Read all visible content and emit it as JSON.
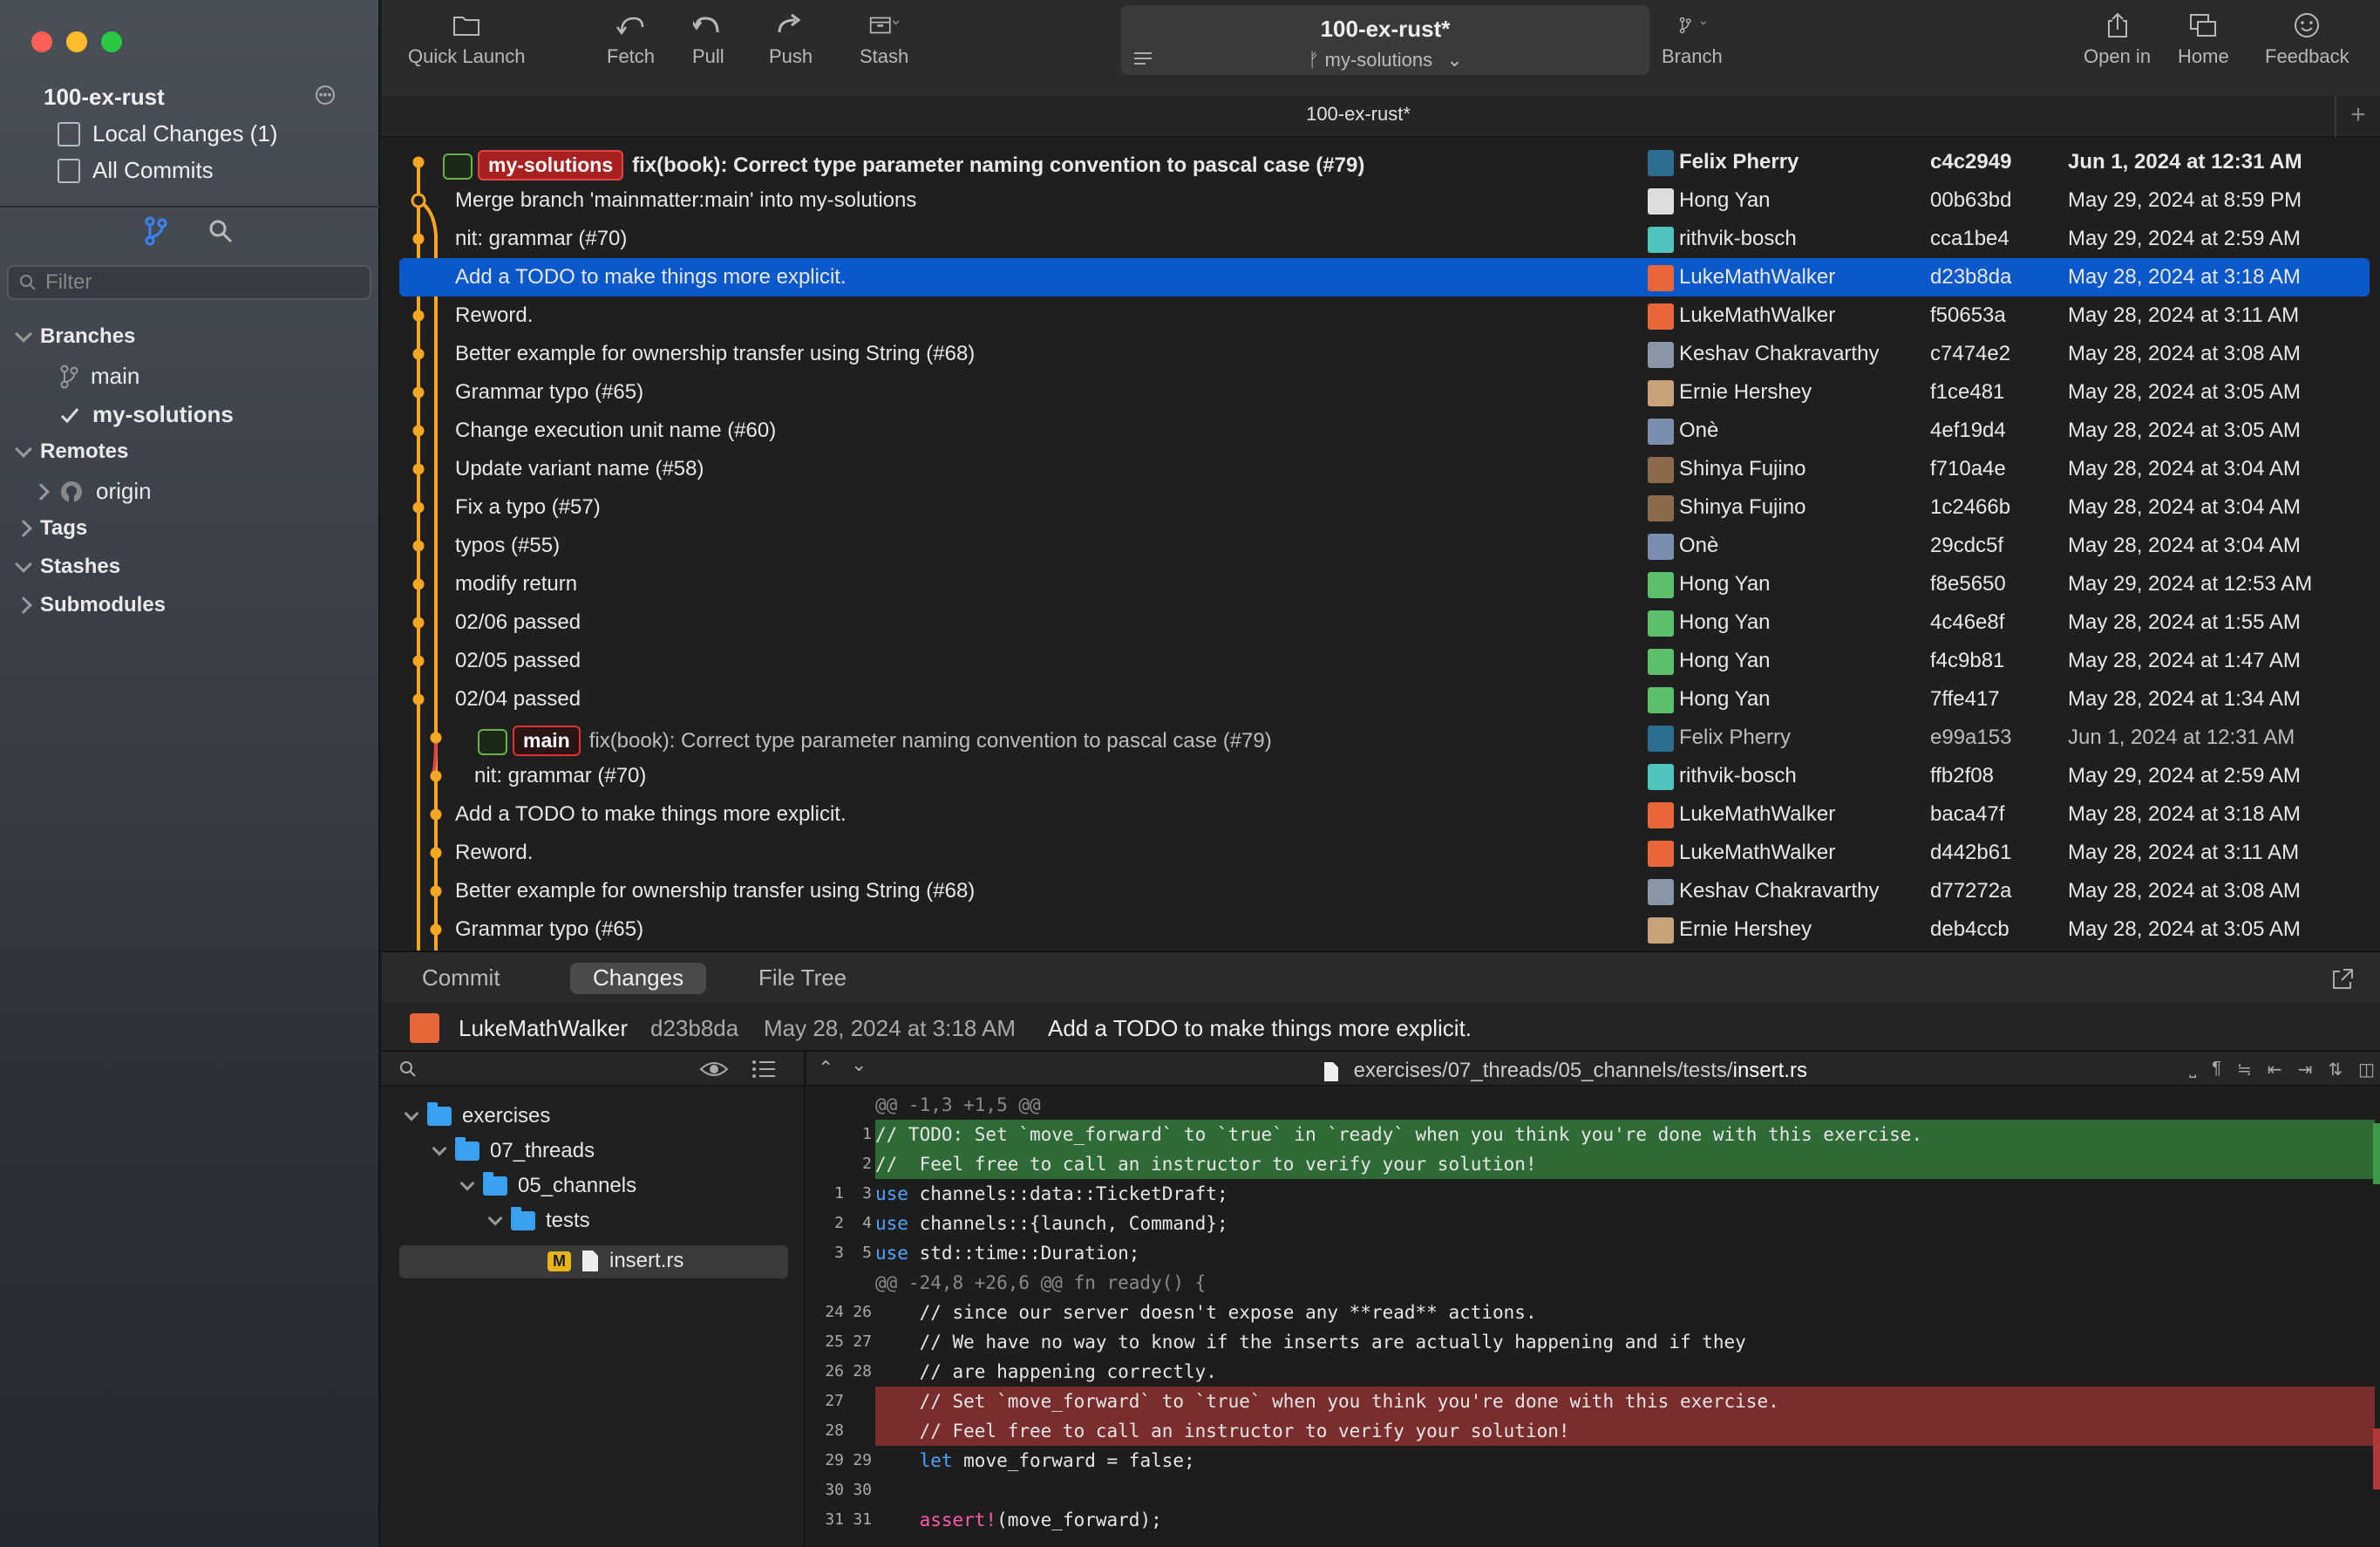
{
  "window": {
    "repo_name": "100-ex-rust"
  },
  "sidebar": {
    "repo_name": "100-ex-rust",
    "local_changes": "Local Changes (1)",
    "all_commits": "All Commits",
    "filter_placeholder": "Filter",
    "branches_header": "Branches",
    "branches": [
      "main",
      "my-solutions"
    ],
    "remotes_header": "Remotes",
    "remotes": [
      "origin"
    ],
    "tags_header": "Tags",
    "stashes_header": "Stashes",
    "submodules_header": "Submodules"
  },
  "toolbar": {
    "quick_launch": "Quick Launch",
    "fetch": "Fetch",
    "pull": "Pull",
    "push": "Push",
    "stash": "Stash",
    "repo_title": "100-ex-rust*",
    "repo_branch": "my-solutions",
    "branch": "Branch",
    "open_in": "Open in",
    "home": "Home",
    "feedback": "Feedback"
  },
  "tab": {
    "label": "100-ex-rust*"
  },
  "commits": [
    {
      "tag": "my-solutions",
      "message": "fix(book): Correct type parameter naming convention to pascal case (#79)",
      "author": "Felix Pherry",
      "sha": "c4c2949",
      "date": "Jun 1, 2024 at 12:31 AM",
      "avatar_color": "#2c6e8f"
    },
    {
      "message": "Merge branch 'mainmatter:main' into my-solutions",
      "author": "Hong Yan",
      "sha": "00b63bd",
      "date": "May 29, 2024 at 8:59 PM",
      "avatar_color": "#dddddd"
    },
    {
      "message": "nit: grammar (#70)",
      "author": "rithvik-bosch",
      "sha": "cca1be4",
      "date": "May 29, 2024 at 2:59 AM",
      "avatar_color": "#4fc3c0"
    },
    {
      "message": "Add a TODO to make things more explicit.",
      "author": "LukeMathWalker",
      "sha": "d23b8da",
      "date": "May 28, 2024 at 3:18 AM",
      "avatar_color": "#e8663a"
    },
    {
      "message": "Reword.",
      "author": "LukeMathWalker",
      "sha": "f50653a",
      "date": "May 28, 2024 at 3:11 AM",
      "avatar_color": "#e8663a"
    },
    {
      "message": "Better example for ownership transfer using String (#68)",
      "author": "Keshav Chakravarthy",
      "sha": "c7474e2",
      "date": "May 28, 2024 at 3:08 AM",
      "avatar_color": "#8896a6"
    },
    {
      "message": "Grammar typo (#65)",
      "author": "Ernie Hershey",
      "sha": "f1ce481",
      "date": "May 28, 2024 at 3:05 AM",
      "avatar_color": "#c9a27a"
    },
    {
      "message": "Change execution unit name (#60)",
      "author": "Onè",
      "sha": "4ef19d4",
      "date": "May 28, 2024 at 3:05 AM",
      "avatar_color": "#7a8fb0"
    },
    {
      "message": "Update variant name (#58)",
      "author": "Shinya Fujino",
      "sha": "f710a4e",
      "date": "May 28, 2024 at 3:04 AM",
      "avatar_color": "#8a6a4a"
    },
    {
      "message": "Fix a typo (#57)",
      "author": "Shinya Fujino",
      "sha": "1c2466b",
      "date": "May 28, 2024 at 3:04 AM",
      "avatar_color": "#8a6a4a"
    },
    {
      "message": "typos (#55)",
      "author": "Onè",
      "sha": "29cdc5f",
      "date": "May 28, 2024 at 3:04 AM",
      "avatar_color": "#7a8fb0"
    },
    {
      "message": "modify return",
      "author": "Hong Yan",
      "sha": "f8e5650",
      "date": "May 29, 2024 at 12:53 AM",
      "avatar_color": "#5cbf6a"
    },
    {
      "message": "02/06 passed",
      "author": "Hong Yan",
      "sha": "4c46e8f",
      "date": "May 28, 2024 at 1:55 AM",
      "avatar_color": "#5cbf6a"
    },
    {
      "message": "02/05 passed",
      "author": "Hong Yan",
      "sha": "f4c9b81",
      "date": "May 28, 2024 at 1:47 AM",
      "avatar_color": "#5cbf6a"
    },
    {
      "message": "02/04 passed",
      "author": "Hong Yan",
      "sha": "7ffe417",
      "date": "May 28, 2024 at 1:34 AM",
      "avatar_color": "#5cbf6a"
    },
    {
      "tag": "main",
      "message": "fix(book): Correct type parameter naming convention to pascal case (#79)",
      "author": "Felix Pherry",
      "sha": "e99a153",
      "date": "Jun 1, 2024 at 12:31 AM",
      "avatar_color": "#2c6e8f"
    },
    {
      "message": "nit: grammar (#70)",
      "author": "rithvik-bosch",
      "sha": "ffb2f08",
      "date": "May 29, 2024 at 2:59 AM",
      "avatar_color": "#4fc3c0"
    },
    {
      "message": "Add a TODO to make things more explicit.",
      "author": "LukeMathWalker",
      "sha": "baca47f",
      "date": "May 28, 2024 at 3:18 AM",
      "avatar_color": "#e8663a"
    },
    {
      "message": "Reword.",
      "author": "LukeMathWalker",
      "sha": "d442b61",
      "date": "May 28, 2024 at 3:11 AM",
      "avatar_color": "#e8663a"
    },
    {
      "message": "Better example for ownership transfer using String (#68)",
      "author": "Keshav Chakravarthy",
      "sha": "d77272a",
      "date": "May 28, 2024 at 3:08 AM",
      "avatar_color": "#8896a6"
    },
    {
      "message": "Grammar typo (#65)",
      "author": "Ernie Hershey",
      "sha": "deb4ccb",
      "date": "May 28, 2024 at 3:05 AM",
      "avatar_color": "#c9a27a"
    }
  ],
  "detail": {
    "tabs": [
      "Commit",
      "Changes",
      "File Tree"
    ],
    "author": "LukeMathWalker",
    "sha": "d23b8da",
    "date": "May 28, 2024 at 3:18 AM",
    "message": "Add a TODO to make things more explicit."
  },
  "file_tree": [
    {
      "name": "exercises"
    },
    {
      "name": "07_threads"
    },
    {
      "name": "05_channels"
    },
    {
      "name": "tests"
    },
    {
      "name": "insert.rs",
      "badge": "M"
    }
  ],
  "diff": {
    "path_prefix": "exercises/07_threads/05_channels/tests/",
    "file": "insert.rs",
    "lines": [
      {
        "t": "hunk",
        "o": "",
        "n": "",
        "text": "@@ -1,3 +1,5 @@"
      },
      {
        "t": "add",
        "o": "",
        "n": "1",
        "text": "// TODO: Set `move_forward` to `true` in `ready` when you think you're done with this exercise."
      },
      {
        "t": "add",
        "o": "",
        "n": "2",
        "text": "//  Feel free to call an instructor to verify your solution!"
      },
      {
        "t": "ctx",
        "o": "1",
        "n": "3",
        "kw": "use",
        "text": " channels::data::TicketDraft;"
      },
      {
        "t": "ctx",
        "o": "2",
        "n": "4",
        "kw": "use",
        "text": " channels::{launch, Command};"
      },
      {
        "t": "ctx",
        "o": "3",
        "n": "5",
        "kw": "use",
        "text": " std::time::Duration;"
      },
      {
        "t": "hunk",
        "o": "",
        "n": "",
        "text": "@@ -24,8 +26,6 @@ fn ready() {"
      },
      {
        "t": "ctx",
        "o": "24",
        "n": "26",
        "text": "    // since our server doesn't expose any **read** actions."
      },
      {
        "t": "ctx",
        "o": "25",
        "n": "27",
        "text": "    // We have no way to know if the inserts are actually happening and if they"
      },
      {
        "t": "ctx",
        "o": "26",
        "n": "28",
        "text": "    // are happening correctly."
      },
      {
        "t": "del",
        "o": "27",
        "n": "",
        "text": "    // Set `move_forward` to `true` when you think you're done with this exercise."
      },
      {
        "t": "del",
        "o": "28",
        "n": "",
        "text": "    // Feel free to call an instructor to verify your solution!"
      },
      {
        "t": "ctx",
        "o": "29",
        "n": "29",
        "pre": "    ",
        "kw": "let",
        "text": " move_forward = false;"
      },
      {
        "t": "ctx",
        "o": "30",
        "n": "30",
        "text": ""
      },
      {
        "t": "ctx",
        "o": "31",
        "n": "31",
        "pre": "    ",
        "mac": "assert!",
        "text": "(move_forward);"
      }
    ]
  },
  "colors": {
    "accent": "#0a58ca",
    "branch_tag": "#a82020",
    "graph_line": "#f5a623",
    "added": "#2f6b36",
    "removed": "#7a2d2d"
  }
}
